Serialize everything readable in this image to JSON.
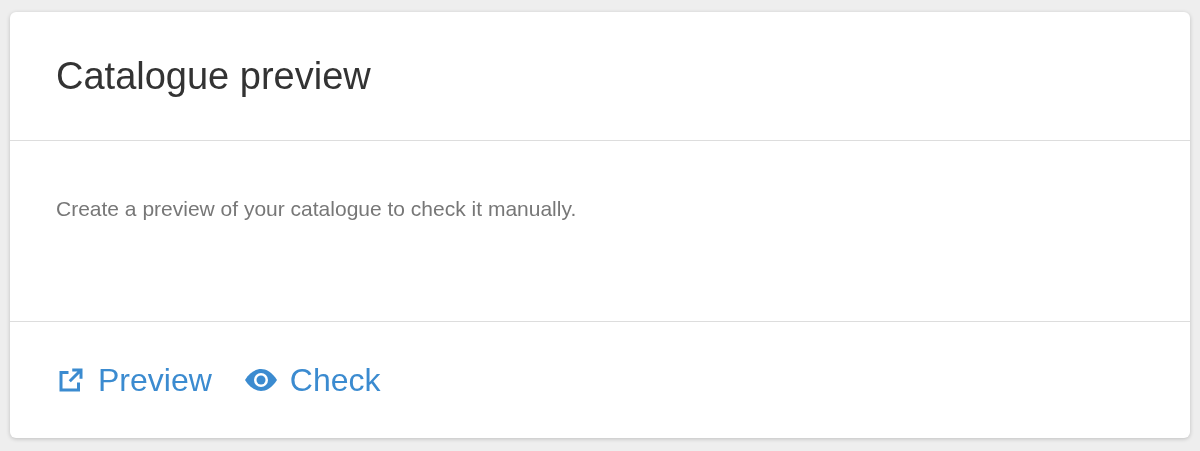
{
  "card": {
    "title": "Catalogue preview",
    "description": "Create a preview of your catalogue to check it manually.",
    "actions": [
      {
        "kind": "external",
        "label": "Preview"
      },
      {
        "kind": "view",
        "label": "Check"
      }
    ]
  }
}
